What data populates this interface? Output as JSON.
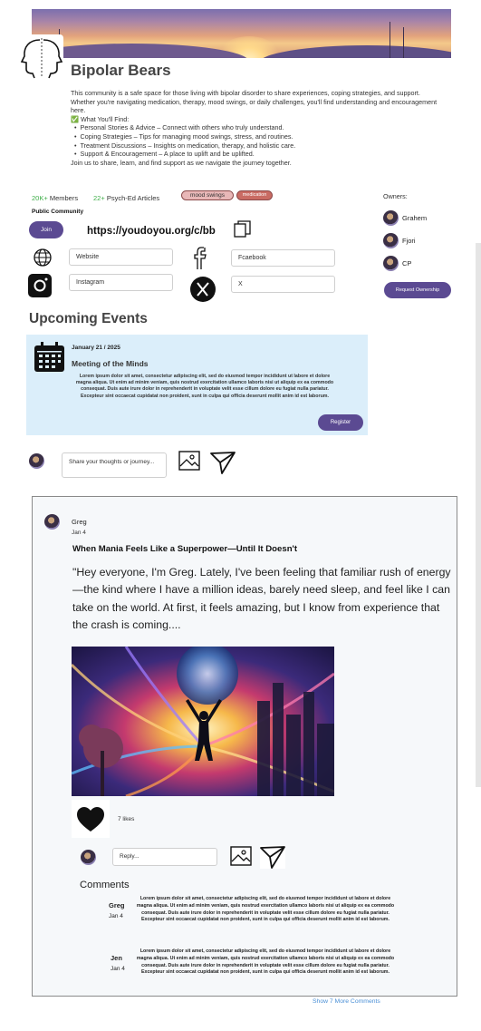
{
  "community": {
    "name": "Bipolar Bears",
    "description_intro": "This community is a safe space for those living with bipolar disorder to share experiences, coping strategies, and support. Whether you're navigating medication, therapy, mood swings, or daily challenges, you'll find understanding and encouragement here.",
    "find_heading": "✅ What You'll Find:",
    "find_items": [
      "Personal Stories & Advice – Connect with others who truly understand.",
      "Coping Strategies – Tips for managing mood swings, stress, and routines.",
      "Treatment Discussions – Insights on medication, therapy, and holistic care.",
      "Support & Encouragement – A place to uplift and be uplifted."
    ],
    "closing": "Join us to share, learn, and find support as we navigate the journey together.",
    "members_count": "20K+",
    "members_label": "Members",
    "articles_count": "22+",
    "articles_label": "Psych-Ed Articles",
    "tags": [
      "mood swings",
      "medication"
    ],
    "visibility": "Public Community",
    "join_label": "Join",
    "url": "https://youdoyou.org/c/bb",
    "links": {
      "website": "Website",
      "facebook": "Fcaebook",
      "instagram": "Instagram",
      "x": "X"
    }
  },
  "owners": {
    "label": "Owners:",
    "names": [
      "Grahem",
      "Fjori",
      "CP"
    ],
    "request_label": "Request Ownership"
  },
  "events": {
    "heading": "Upcoming Events",
    "items": [
      {
        "date": "January 21 / 2025",
        "name": "Meeting of the Minds",
        "body": "Lorem ipsum dolor sit amet, consectetur adipiscing elit, sed do eiusmod tempor incididunt ut labore et dolore magna aliqua. Ut enim ad minim veniam, quis nostrud exercitation ullamco laboris nisi ut aliquip ex ea commodo consequat. Duis aute irure dolor in reprehenderit in voluptate velit esse cillum dolore eu fugiat nulla pariatur. Excepteur sint occaecat cupidatat non proident, sunt in culpa qui officia deserunt mollit anim id est laborum.",
        "register_label": "Register"
      }
    ]
  },
  "composer": {
    "placeholder": "Share your thoughts or journey..."
  },
  "post": {
    "user": "Greg",
    "date": "Jan 4",
    "title": "When Mania Feels Like a Superpower—Until It Doesn't",
    "body": "\"Hey everyone, I'm Greg. Lately, I've been feeling that familiar rush of energy—the kind where I have a million ideas, barely need sleep, and feel like I can take on the world. At first, it feels amazing, but I know from experience that the crash is coming....",
    "likes": "7 likes",
    "reply_placeholder": "Reply...",
    "comments_heading": "Comments",
    "comments": [
      {
        "user": "Greg",
        "date": "Jan 4",
        "body": "Lorem ipsum dolor sit amet, consectetur adipiscing elit, sed do eiusmod tempor incididunt ut labore et dolore magna aliqua. Ut enim ad minim veniam, quis nostrud exercitation ullamco laboris nisi ut aliquip ex ea commodo consequat. Duis aute irure dolor in reprehenderit in voluptate velit esse cillum dolore eu fugiat nulla pariatur. Excepteur sint occaecat cupidatat non proident, sunt in culpa qui officia deserunt mollit anim id est laborum."
      },
      {
        "user": "Jen",
        "date": "Jan 4",
        "body": "Lorem ipsum dolor sit amet, consectetur adipiscing elit, sed do eiusmod tempor incididunt ut labore et dolore magna aliqua. Ut enim ad minim veniam, quis nostrud exercitation ullamco laboris nisi ut aliquip ex ea commodo consequat. Duis aute irure dolor in reprehenderit in voluptate velit esse cillum dolore eu fugiat nulla pariatur. Excepteur sint occaecat cupidatat non proident, sunt in culpa qui officia deserunt mollit anim id est laborum."
      }
    ],
    "more_comments": "Show 7 More Comments"
  },
  "colors": {
    "accent": "#5b4a92",
    "event_bg": "#dbeefa",
    "tag_fill": "#e8b7b7",
    "tag_fill_dark": "#c96b63",
    "stat_green": "#3fae49",
    "link_blue": "#4a8fd6"
  },
  "icons": [
    "head-logo-icon",
    "copy-icon",
    "globe-icon",
    "facebook-icon",
    "instagram-icon",
    "x-icon",
    "calendar-icon",
    "image-icon",
    "send-icon",
    "heart-icon"
  ]
}
